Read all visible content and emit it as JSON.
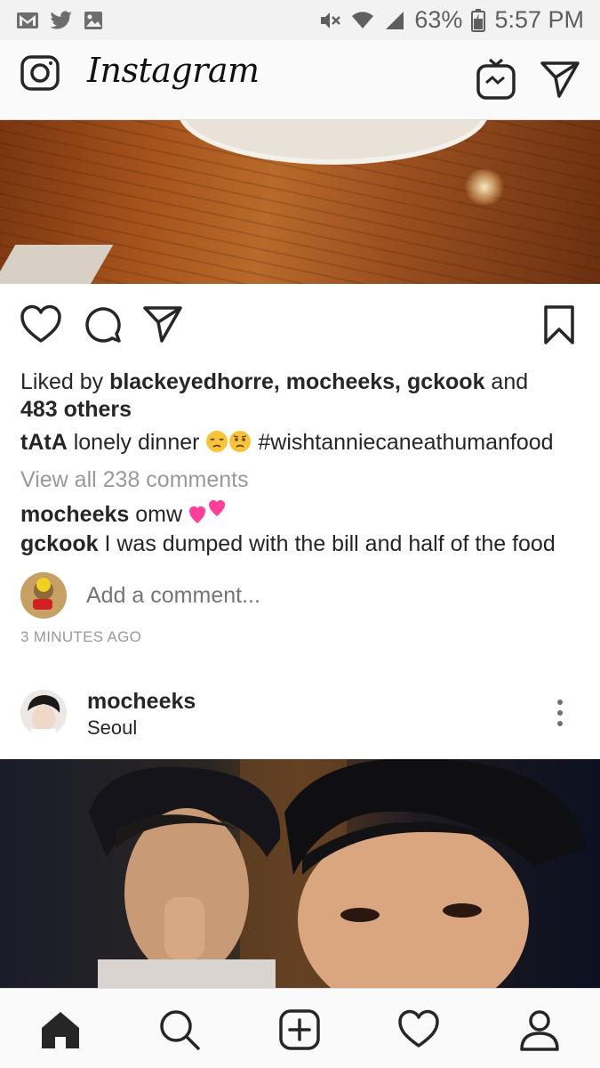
{
  "status_bar": {
    "battery": "63%",
    "time": "5:57 PM",
    "left_icons": [
      "gmail-icon",
      "twitter-icon",
      "gallery-icon"
    ],
    "right_icons": [
      "mute-icon",
      "wifi-icon",
      "signal-icon",
      "battery-icon"
    ]
  },
  "header": {
    "logo": "Instagram",
    "icons": [
      "camera-icon",
      "igtv-icon",
      "direct-message-icon"
    ]
  },
  "post1": {
    "likes_prefix": "Liked by ",
    "likers": "blackeyedhorre, mocheeks, gckook",
    "likes_and": " and",
    "likes_others": "483 others",
    "caption_user": "tAtA",
    "caption_text": " lonely dinner ",
    "caption_hashtag": " #wishtanniecaneathumanfood",
    "view_comments": "View all 238 comments",
    "comments": [
      {
        "user": "mocheeks",
        "text": " omw "
      },
      {
        "user": "gckook",
        "text": " I was dumped with the bill and half of the food"
      }
    ],
    "add_comment_placeholder": "Add a comment...",
    "timestamp": "3 MINUTES AGO"
  },
  "post2": {
    "username": "mocheeks",
    "location": "Seoul"
  },
  "bottom_nav": {
    "items": [
      "home-icon",
      "search-icon",
      "new-post-icon",
      "activity-icon",
      "profile-icon"
    ]
  },
  "colors": {
    "text": "#262626",
    "muted": "#999999",
    "border": "#dbdbdb",
    "heart_emoji": "#ff3f9a"
  }
}
